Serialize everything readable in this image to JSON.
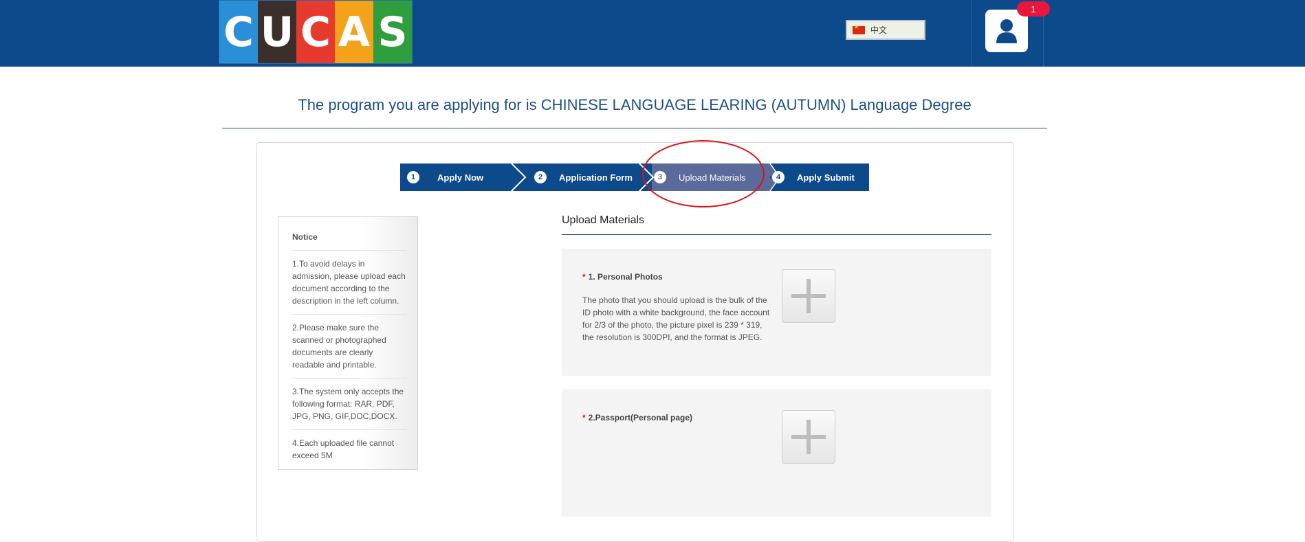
{
  "header": {
    "logo_letters": [
      "C",
      "U",
      "C",
      "A",
      "S"
    ],
    "logo_colors": [
      "#2a8fd6",
      "#3a2f2a",
      "#e63a2e",
      "#f3a21a",
      "#2e9e3e"
    ],
    "language_label": "中文",
    "notification_count": "1",
    "bg_color": "#0d4a8c"
  },
  "program_title": "The program you are applying for is CHINESE LANGUAGE LEARING (AUTUMN) Language Degree",
  "steps": [
    {
      "num": "1",
      "label": "Apply Now"
    },
    {
      "num": "2",
      "label": "Application Form"
    },
    {
      "num": "3",
      "label": "Upload Materials",
      "active": true
    },
    {
      "num": "4",
      "label": "Apply Submit"
    }
  ],
  "notice": {
    "title": "Notice",
    "items": [
      "1.To avoid delays in admission, please upload each document according to the description in the left column.",
      "2.Please make sure the scanned or photographed documents are clearly readable and printable.",
      "3.The system only accepts the following format: RAR, PDF, JPG, PNG, GIF,DOC,DOCX.",
      "4.Each uploaded file cannot exceed 5M"
    ]
  },
  "upload": {
    "heading": "Upload Materials",
    "items": [
      {
        "required_mark": "*",
        "label": "1. Personal Photos",
        "description": "The photo that you should upload is the bulk of the ID photo with a white background, the face account for 2/3 of the photo, the picture pixel is 239 * 319, the resolution is 300DPI, and the format is JPEG."
      },
      {
        "required_mark": "*",
        "label": "2.Passport(Personal page)",
        "description": ""
      }
    ]
  }
}
